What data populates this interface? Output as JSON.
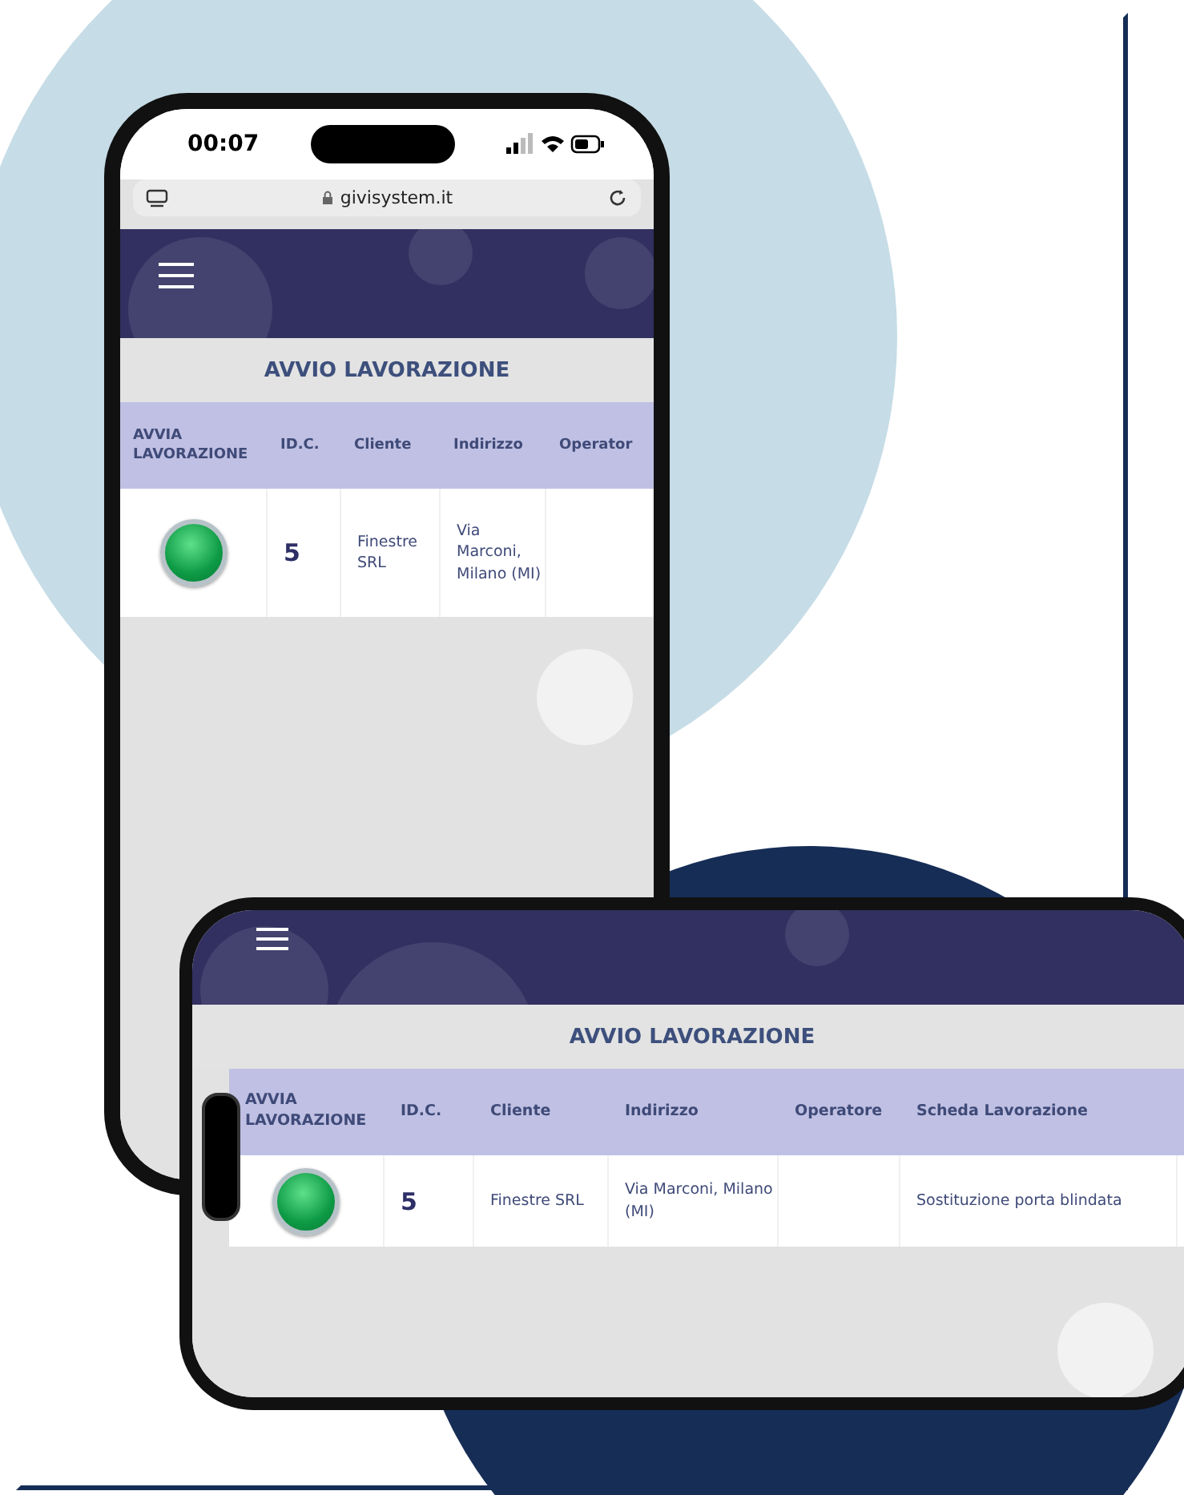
{
  "portrait": {
    "status_bar": {
      "time": "00:07"
    },
    "address_bar": {
      "url": "givisystem.it"
    },
    "page_title": "AVVIO LAVORAZIONE",
    "table": {
      "columns": [
        "AVVIA LAVORAZIONE",
        "ID.C.",
        "Cliente",
        "Indirizzo",
        "Operator"
      ],
      "rows": [
        {
          "cells": [
            {
              "kind": "button"
            },
            {
              "kind": "id",
              "text": "5"
            },
            {
              "kind": "text",
              "text": "Finestre SRL"
            },
            {
              "kind": "text",
              "text": "Via Marconi, Milano (MI)"
            },
            {
              "kind": "empty"
            }
          ]
        }
      ]
    }
  },
  "landscape": {
    "page_title": "AVVIO LAVORAZIONE",
    "table": {
      "columns": [
        "AVVIA LAVORAZIONE",
        "ID.C.",
        "Cliente",
        "Indirizzo",
        "Operatore",
        "Scheda Lavorazione"
      ],
      "rows": [
        {
          "cells": [
            {
              "kind": "button"
            },
            {
              "kind": "id",
              "text": "5"
            },
            {
              "kind": "text",
              "text": "Finestre SRL"
            },
            {
              "kind": "text",
              "text": "Via Marconi, Milano (MI)"
            },
            {
              "kind": "empty"
            },
            {
              "kind": "text",
              "text": "Sostituzione porta blindata"
            }
          ]
        }
      ]
    }
  }
}
